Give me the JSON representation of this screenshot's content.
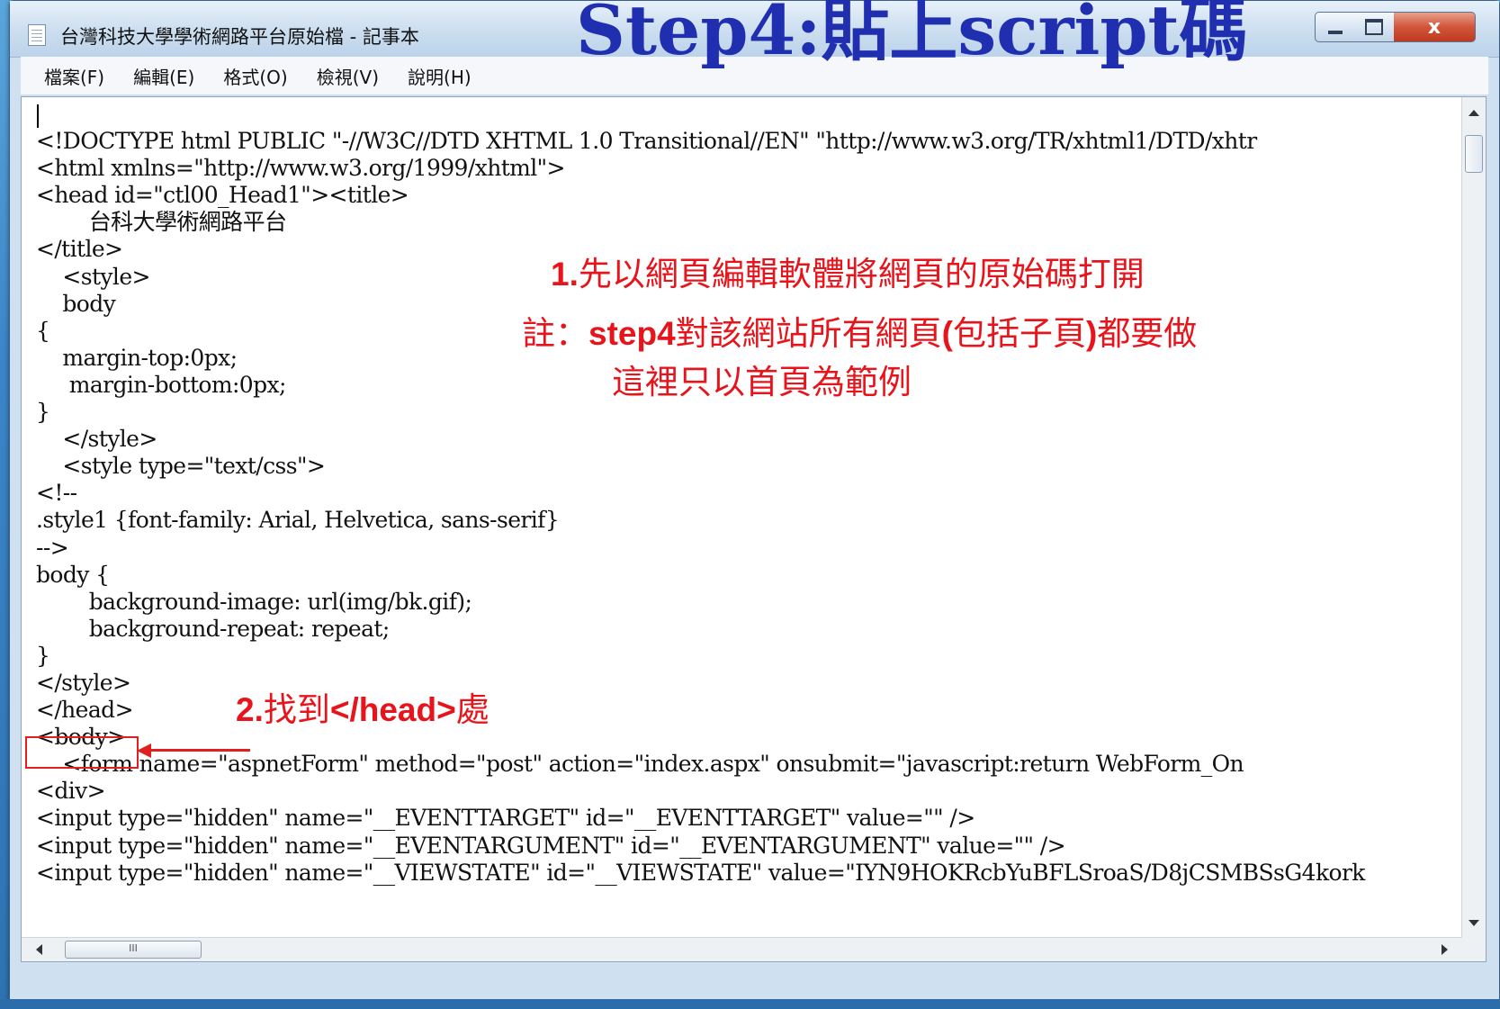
{
  "window": {
    "title": "台灣科技大學學術網路平台原始檔 - 記事本",
    "close_glyph": "x"
  },
  "slide": {
    "heading": "Step4:貼上script碼"
  },
  "menu": [
    {
      "label": "檔案(F)"
    },
    {
      "label": "編輯(E)"
    },
    {
      "label": "格式(O)"
    },
    {
      "label": "檢視(V)"
    },
    {
      "label": "說明(H)"
    }
  ],
  "code_lines": [
    "",
    "<!DOCTYPE html PUBLIC \"-//W3C//DTD XHTML 1.0 Transitional//EN\" \"http://www.w3.org/TR/xhtml1/DTD/xhtr",
    "<html xmlns=\"http://www.w3.org/1999/xhtml\">",
    "<head id=\"ctl00_Head1\"><title>",
    "        台科大學術網路平台",
    "</title>",
    "    <style>",
    "    body",
    "{",
    "    margin-top:0px;",
    "     margin-bottom:0px;",
    "}",
    "    </style>",
    "    <style type=\"text/css\">",
    "<!--",
    ".style1 {font-family: Arial, Helvetica, sans-serif}",
    "-->",
    "body {",
    "        background-image: url(img/bk.gif);",
    "        background-repeat: repeat;",
    "}",
    "</style>",
    "</head>",
    "<body>",
    "    <form name=\"aspnetForm\" method=\"post\" action=\"index.aspx\" onsubmit=\"javascript:return WebForm_On",
    "<div>",
    "<input type=\"hidden\" name=\"__EVENTTARGET\" id=\"__EVENTTARGET\" value=\"\" />",
    "<input type=\"hidden\" name=\"__EVENTARGUMENT\" id=\"__EVENTARGUMENT\" value=\"\" />",
    "<input type=\"hidden\" name=\"__VIEWSTATE\" id=\"__VIEWSTATE\" value=\"IYN9HOKRcbYuBFLSroaS/D8jCSMBSsG4kork"
  ],
  "annotations": {
    "step1_num": "1.",
    "step1_text": "先以網頁編輯軟體將網頁的原始碼打開",
    "note_prefix": "註：",
    "note_bold1": "step4",
    "note_text1": "對該網站所有網頁",
    "note_bold2": "(",
    "note_text2": "包括子頁",
    "note_bold3": ")",
    "note_text3": "都要做",
    "note_line2": "這裡只以首頁為範例",
    "step2_num": "2.",
    "step2_text1": "找到",
    "step2_bold": "</head>",
    "step2_text2": "處"
  },
  "scrollbar": {
    "h_thumb_label": "III"
  },
  "colors": {
    "annotation_red": "#e8141b",
    "heading_blue": "#1f2fb0"
  }
}
